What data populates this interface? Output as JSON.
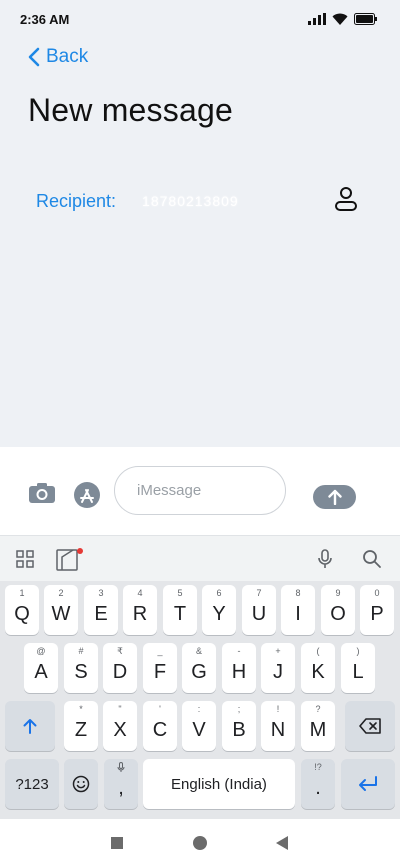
{
  "status_bar": {
    "time": "2:36 AM"
  },
  "header": {
    "back_label": "Back",
    "title": "New message"
  },
  "recipient": {
    "label": "Recipient:",
    "value": "18780213809"
  },
  "composer": {
    "placeholder": "iMessage"
  },
  "keyboard": {
    "row1": [
      {
        "hint": "1",
        "label": "Q"
      },
      {
        "hint": "2",
        "label": "W"
      },
      {
        "hint": "3",
        "label": "E"
      },
      {
        "hint": "4",
        "label": "R"
      },
      {
        "hint": "5",
        "label": "T"
      },
      {
        "hint": "6",
        "label": "Y"
      },
      {
        "hint": "7",
        "label": "U"
      },
      {
        "hint": "8",
        "label": "I"
      },
      {
        "hint": "9",
        "label": "O"
      },
      {
        "hint": "0",
        "label": "P"
      }
    ],
    "row2": [
      {
        "hint": "@",
        "label": "A"
      },
      {
        "hint": "#",
        "label": "S"
      },
      {
        "hint": "₹",
        "label": "D"
      },
      {
        "hint": "_",
        "label": "F"
      },
      {
        "hint": "&",
        "label": "G"
      },
      {
        "hint": "-",
        "label": "H"
      },
      {
        "hint": "+",
        "label": "J"
      },
      {
        "hint": "(",
        "label": "K"
      },
      {
        "hint": ")",
        "label": "L"
      }
    ],
    "row3": [
      {
        "hint": "*",
        "label": "Z"
      },
      {
        "hint": "\"",
        "label": "X"
      },
      {
        "hint": "'",
        "label": "C"
      },
      {
        "hint": ":",
        "label": "V"
      },
      {
        "hint": ";",
        "label": "B"
      },
      {
        "hint": "!",
        "label": "N"
      },
      {
        "hint": "?",
        "label": "M"
      }
    ],
    "symbols_label": "?123",
    "comma_label": ",",
    "space_label": "English (India)",
    "period_hint": "!?",
    "period_label": "."
  },
  "colors": {
    "accent": "#1e88e5",
    "send_button": "#7e8a97"
  }
}
